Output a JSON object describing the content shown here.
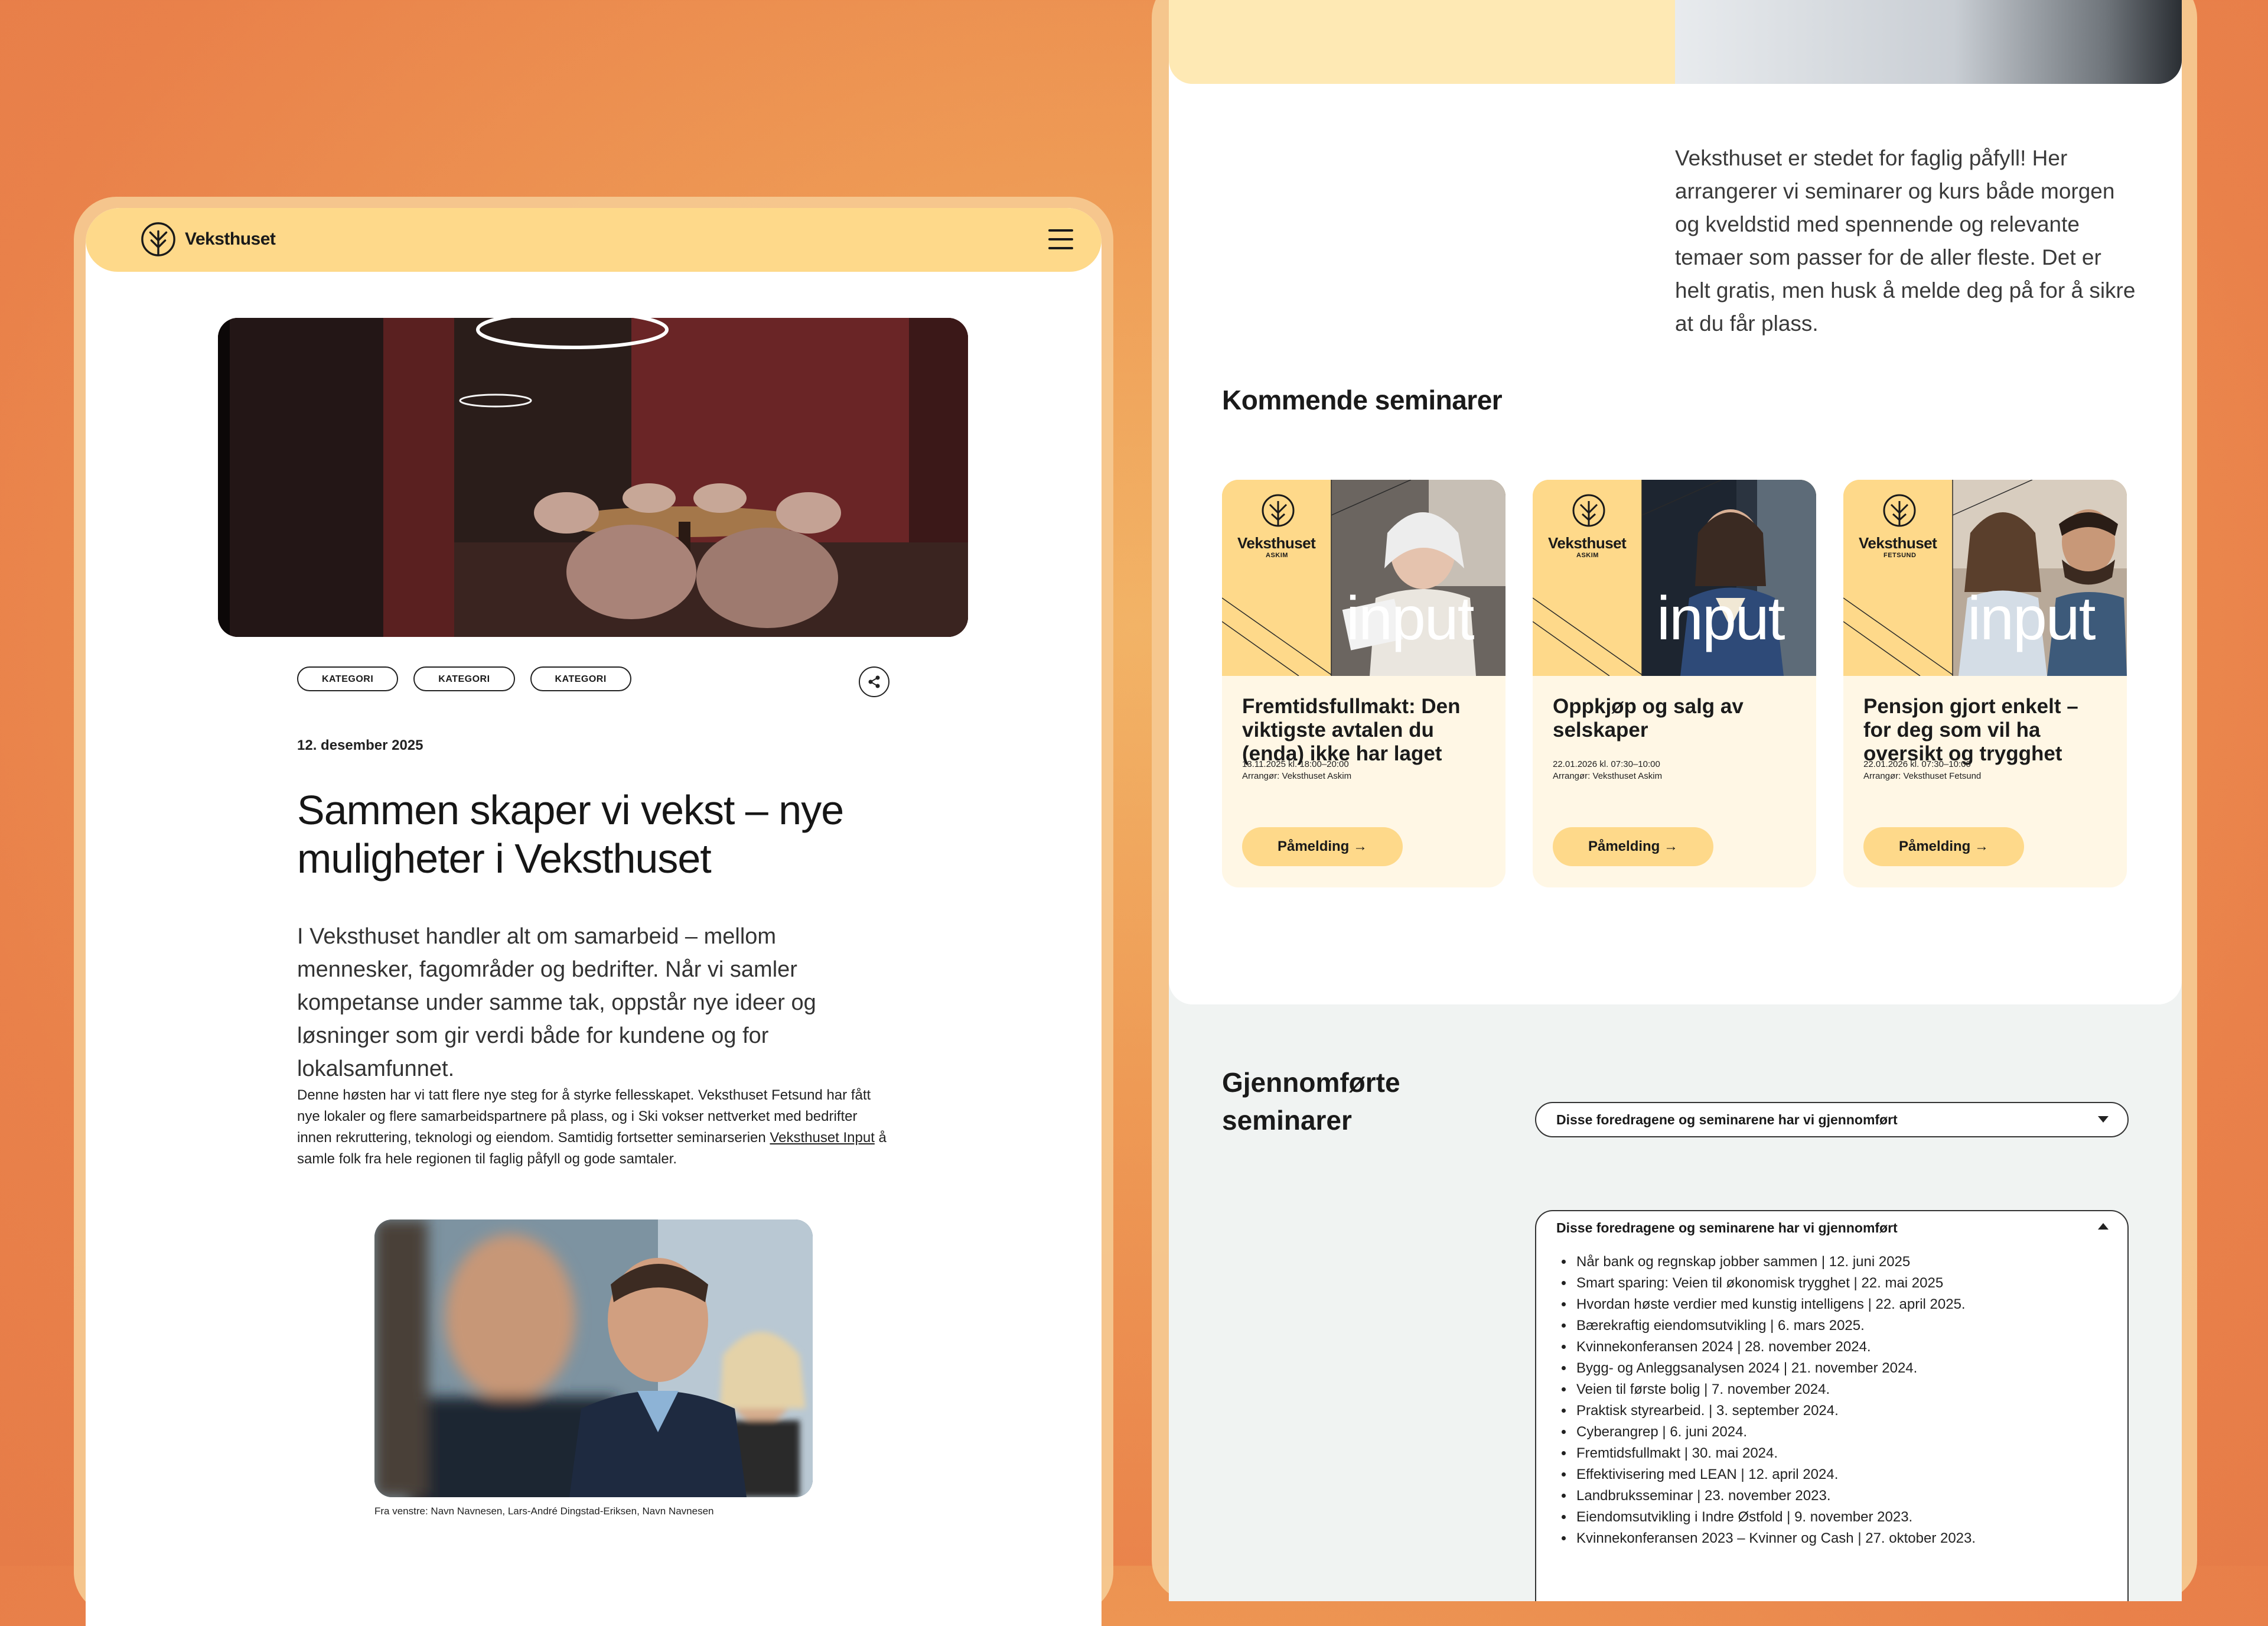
{
  "left": {
    "nav": {
      "brand": "Veksthuset"
    },
    "tags": [
      "KATEGORI",
      "KATEGORI",
      "KATEGORI"
    ],
    "date": "12. desember 2025",
    "title": "Sammen skaper vi vekst – nye muligheter i Veksthuset",
    "lead": "I Veksthuset handler alt om samarbeid – mellom mennesker, fagområder og bedrifter. Når vi samler kompetanse under samme tak, oppstår nye ideer og løsninger som gir verdi både for kundene og for lokalsamfunnet.",
    "body_before_link": "Denne høsten har vi tatt flere nye steg for å styrke fellesskapet. Veksthuset Fetsund har fått nye lokaler og flere samarbeidspartnere på plass, og i Ski vokser nettverket med bedrifter innen rekruttering, teknologi og eiendom. Samtidig fortsetter seminarserien ",
    "body_link": "Veksthuset Input",
    "body_after_link": " å samle folk fra hele regionen til faglig påfyll og gode samtaler.",
    "caption": "Fra venstre: Navn Navnesen, Lars-André Dingstad-Eriksen, Navn Navnesen"
  },
  "right": {
    "intro": "Veksthuset er stedet for faglig påfyll! Her arrangerer vi seminarer og kurs både morgen og kveldstid med spennende og relevante temaer som passer for de aller fleste. Det er helt gratis, men husk å melde deg på for å sikre at du får plass.",
    "upcoming_heading": "Kommende seminarer",
    "cards": [
      {
        "brand": "Veksthuset",
        "location": "ASKIM",
        "series": "input",
        "title": "Fremtidsfullmakt: Den viktigste avtalen du (enda) ikke har laget",
        "when": "13.11.2025 kl. 18:00–20:00",
        "organizer": "Arrangør: Veksthuset Askim",
        "button": "Påmelding"
      },
      {
        "brand": "Veksthuset",
        "location": "ASKIM",
        "series": "input",
        "title": "Oppkjøp og salg av selskaper",
        "when": "22.01.2026 kl. 07:30–10:00",
        "organizer": "Arrangør: Veksthuset Askim",
        "button": "Påmelding"
      },
      {
        "brand": "Veksthuset",
        "location": "FETSUND",
        "series": "input",
        "title": "Pensjon gjort enkelt – for deg som vil ha oversikt og trygghet",
        "when": "22.01.2026 kl. 07:30–10:00",
        "organizer": "Arrangør: Veksthuset Fetsund",
        "button": "Påmelding"
      }
    ],
    "done_heading": "Gjennomførte seminarer",
    "dropdown_label": "Disse foredragene og seminarene har vi gjennomført",
    "expanded_label": "Disse foredragene og seminarene har vi gjennomført",
    "past_seminars": [
      "Når bank og regnskap jobber sammen | 12. juni 2025",
      "Smart sparing: Veien til økonomisk trygghet | 22. mai 2025",
      "Hvordan høste verdier med kunstig intelligens | 22. april 2025.",
      "Bærekraftig eiendomsutvikling | 6. mars 2025.",
      "Kvinnekonferansen 2024 | 28. november 2024.",
      "Bygg- og Anleggsanalysen 2024 | 21. november 2024.",
      "Veien til første bolig | 7. november 2024.",
      "Praktisk styrearbeid. | 3. september 2024.",
      "Cyberangrep | 6. juni 2024.",
      "Fremtidsfullmakt | 30. mai 2024.",
      "Effektivisering med LEAN | 12. april 2024.",
      "Landbruksseminar | 23. november 2023.",
      "Eiendomsutvikling i Indre Østfold | 9. november 2023.",
      "Kvinnekonferansen 2023 – Kvinner og Cash | 27. oktober 2023."
    ]
  },
  "colors": {
    "background": "#e9814a",
    "brand_yellow": "#fed98a",
    "card_bg": "#fff7e5",
    "light_yellow": "#fee9b4"
  }
}
